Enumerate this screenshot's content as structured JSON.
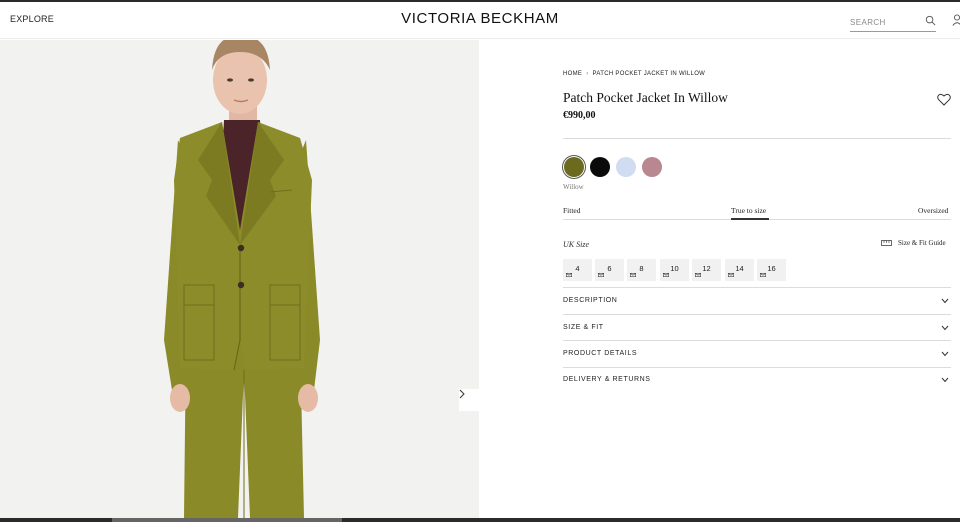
{
  "header": {
    "explore": "EXPLORE",
    "brand": "VICTORIA BECKHAM",
    "search_placeholder": "SEARCH",
    "icons": [
      "search-icon",
      "account-icon"
    ]
  },
  "breadcrumb": [
    "HOME",
    "PATCH POCKET JACKET IN WILLOW"
  ],
  "breadcrumb_separator": "›",
  "product": {
    "title": "Patch Pocket Jacket In Willow",
    "price": "€990,00",
    "selected_color_name": "Willow"
  },
  "colors": [
    {
      "name": "Willow",
      "hex": "#6b6a1e",
      "selected": true
    },
    {
      "name": "",
      "hex": "#0a0a0a",
      "selected": false
    },
    {
      "name": "",
      "hex": "#cfdcf1",
      "selected": false
    },
    {
      "name": "",
      "hex": "#b9878f",
      "selected": false
    }
  ],
  "fit": {
    "left": "Fitted",
    "center": "True to size",
    "right": "Oversized",
    "selected": "True to size"
  },
  "size": {
    "label": "UK Size",
    "guide_label": "Size & Fit Guide",
    "options": [
      "4",
      "6",
      "8",
      "10",
      "12",
      "14",
      "16"
    ]
  },
  "accordion": [
    "DESCRIPTION",
    "SIZE & FIT",
    "PRODUCT DETAILS",
    "DELIVERY & RETURNS"
  ],
  "gallery": {
    "next_icon": "chevron-right-icon",
    "garment_color": "#8b8a26"
  }
}
